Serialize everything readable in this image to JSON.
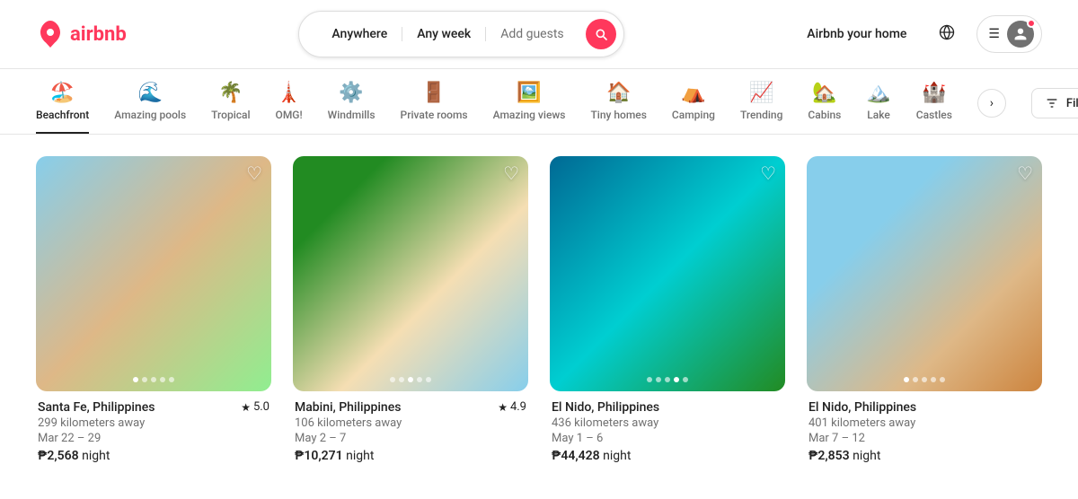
{
  "header": {
    "logo_text": "airbnb",
    "search": {
      "location_placeholder": "Anywhere",
      "week_placeholder": "Any week",
      "guests_placeholder": "Add guests"
    },
    "nav_right": {
      "host_label": "Airbnb your home",
      "menu_label": "☰",
      "notification_badge": true
    }
  },
  "categories": [
    {
      "id": "beachfront",
      "label": "Beachfront",
      "icon": "🏖️",
      "active": true
    },
    {
      "id": "amazing-pools",
      "label": "Amazing pools",
      "icon": "🌊",
      "active": false
    },
    {
      "id": "tropical",
      "label": "Tropical",
      "icon": "🌴",
      "active": false
    },
    {
      "id": "omg",
      "label": "OMG!",
      "icon": "🗼",
      "active": false
    },
    {
      "id": "windmills",
      "label": "Windmills",
      "icon": "⚙️",
      "active": false
    },
    {
      "id": "private-rooms",
      "label": "Private rooms",
      "icon": "🚪",
      "active": false
    },
    {
      "id": "amazing-views",
      "label": "Amazing views",
      "icon": "🖼️",
      "active": false
    },
    {
      "id": "tiny-homes",
      "label": "Tiny homes",
      "icon": "🏠",
      "active": false
    },
    {
      "id": "camping",
      "label": "Camping",
      "icon": "⛺",
      "active": false
    },
    {
      "id": "trending",
      "label": "Trending",
      "icon": "📈",
      "active": false
    },
    {
      "id": "cabins",
      "label": "Cabins",
      "icon": "🏡",
      "active": false
    },
    {
      "id": "lake",
      "label": "Lake",
      "icon": "🏔️",
      "active": false
    },
    {
      "id": "castles",
      "label": "Castles",
      "icon": "🏰",
      "active": false
    }
  ],
  "filters_label": "Filters",
  "listings": [
    {
      "id": 1,
      "location": "Santa Fe, Philippines",
      "rating": "5.0",
      "distance": "299 kilometers away",
      "dates": "Mar 22 – 29",
      "price": "₱2,568",
      "price_suffix": "night",
      "dots": [
        true,
        false,
        false,
        false,
        false
      ],
      "img_class": "img-placeholder-1"
    },
    {
      "id": 2,
      "location": "Mabini, Philippines",
      "rating": "4.9",
      "distance": "106 kilometers away",
      "dates": "May 2 – 7",
      "price": "₱10,271",
      "price_suffix": "night",
      "dots": [
        false,
        false,
        true,
        false,
        false
      ],
      "img_class": "img-placeholder-2"
    },
    {
      "id": 3,
      "location": "El Nido, Philippines",
      "rating": "",
      "distance": "436 kilometers away",
      "dates": "May 1 – 6",
      "price": "₱44,428",
      "price_suffix": "night",
      "dots": [
        false,
        false,
        false,
        true,
        false
      ],
      "img_class": "img-placeholder-3"
    },
    {
      "id": 4,
      "location": "El Nido, Philippines",
      "rating": "",
      "distance": "401 kilometers away",
      "dates": "Mar 7 – 12",
      "price": "₱2,853",
      "price_suffix": "night",
      "dots": [
        true,
        false,
        false,
        false,
        false
      ],
      "img_class": "img-placeholder-4"
    }
  ]
}
